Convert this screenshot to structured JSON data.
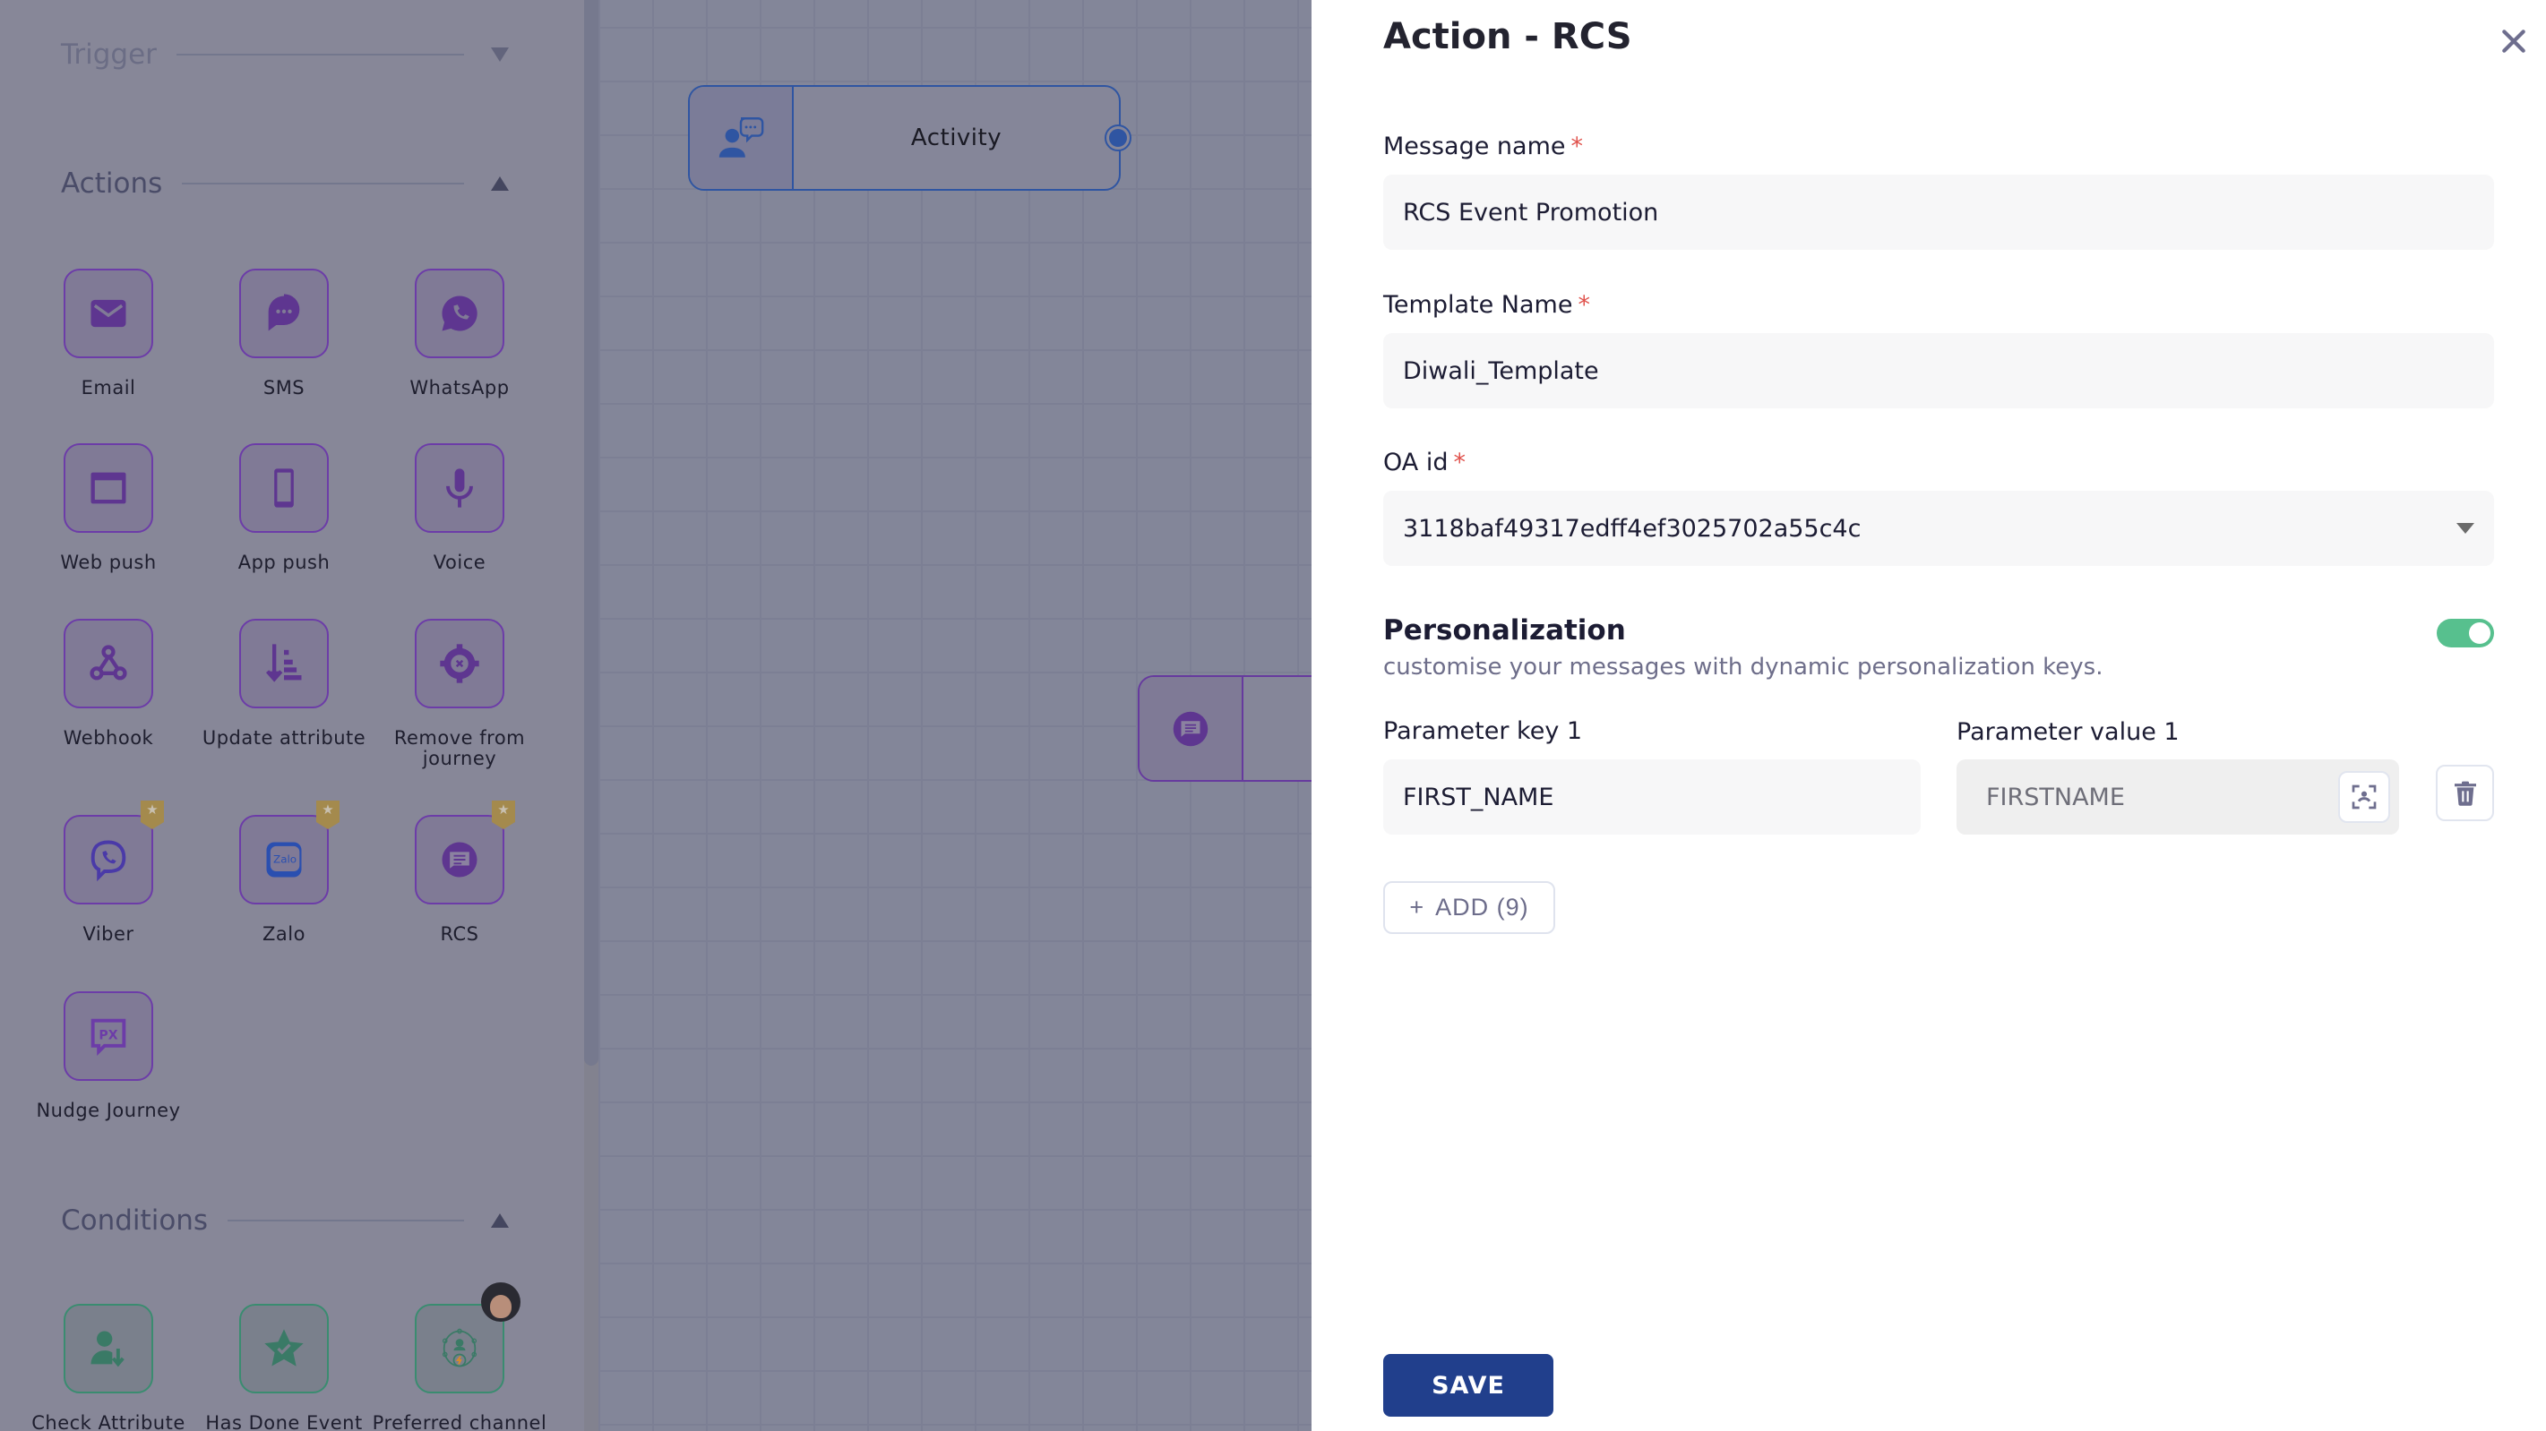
{
  "sidebar": {
    "sections": {
      "trigger": {
        "title": "Trigger",
        "state": "collapsed"
      },
      "actions": {
        "title": "Actions",
        "state": "expanded"
      },
      "conditions": {
        "title": "Conditions",
        "state": "expanded"
      }
    },
    "actions": [
      {
        "label": "Email",
        "icon": "email-icon",
        "premium": false
      },
      {
        "label": "SMS",
        "icon": "sms-icon",
        "premium": false
      },
      {
        "label": "WhatsApp",
        "icon": "whatsapp-icon",
        "premium": false
      },
      {
        "label": "Web push",
        "icon": "web-push-icon",
        "premium": false
      },
      {
        "label": "App push",
        "icon": "app-push-icon",
        "premium": false
      },
      {
        "label": "Voice",
        "icon": "microphone-icon",
        "premium": false
      },
      {
        "label": "Webhook",
        "icon": "webhook-icon",
        "premium": false
      },
      {
        "label": "Update attribute",
        "icon": "update-attribute-icon",
        "premium": false
      },
      {
        "label": "Remove from journey",
        "icon": "remove-gear-icon",
        "premium": false
      },
      {
        "label": "Viber",
        "icon": "viber-icon",
        "premium": true
      },
      {
        "label": "Zalo",
        "icon": "zalo-icon",
        "premium": true
      },
      {
        "label": "RCS",
        "icon": "rcs-icon",
        "premium": true
      },
      {
        "label": "Nudge Journey",
        "icon": "nudge-px-icon",
        "premium": false
      }
    ],
    "conditions": [
      {
        "label": "Check Attribute",
        "icon": "check-attribute-icon"
      },
      {
        "label": "Has Done Event",
        "icon": "star-check-icon"
      },
      {
        "label": "Preferred channel",
        "icon": "preferred-channel-icon"
      }
    ],
    "premium_badge": "★"
  },
  "canvas": {
    "nodes": [
      {
        "label": "Activity",
        "icon": "activity-user-chat-icon"
      },
      {
        "label": "",
        "icon": "rcs-icon"
      }
    ]
  },
  "panel": {
    "title": "Action - RCS",
    "close_icon": "✕",
    "required_mark": "*",
    "message_name": {
      "label": "Message name",
      "value": "RCS Event Promotion"
    },
    "template_name": {
      "label": "Template Name",
      "value": "Diwali_Template"
    },
    "oa_id": {
      "label": "OA id",
      "value": "3118baf49317edff4ef3025702a55c4c"
    },
    "personalization": {
      "title": "Personalization",
      "description": "customise your messages with dynamic personalization keys.",
      "enabled": true,
      "params": [
        {
          "key_label": "Parameter key 1",
          "key_value": "FIRST_NAME",
          "value_label": "Parameter value 1",
          "value_value": "FIRSTNAME"
        }
      ],
      "add_label": "ADD (9)",
      "add_icon": "+"
    },
    "save_label": "SAVE"
  },
  "colors": {
    "primary": "#213f8c",
    "toggle_on": "#57c08e",
    "required": "#e0524c",
    "action_purple": "#6c3ca8",
    "condition_green": "#3a8c70"
  }
}
